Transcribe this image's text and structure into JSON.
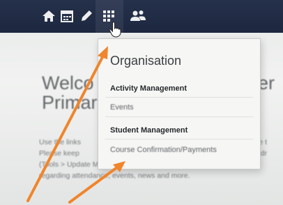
{
  "navbar": {
    "icons": [
      "home-icon",
      "calendar-icon",
      "pencil-icon",
      "apps-grid-icon",
      "people-icon"
    ],
    "colors": {
      "background": "#1f2942",
      "icon": "#ffffff"
    }
  },
  "page": {
    "welcome_left": "Welco\nPrimar",
    "welcome_right": "er",
    "body_left": "Use the links\nPlease keep\n(Tools > Update My Details). The school will use this to c\nregarding attendance, events, news and more.",
    "body_right": "ore t\naddr"
  },
  "dropdown": {
    "heading": "Organisation",
    "sections": [
      {
        "title": "Activity Management",
        "items": [
          "Events"
        ]
      },
      {
        "title": "Student Management",
        "items": [
          "Course Confirmation/Payments"
        ]
      }
    ]
  },
  "annotation": {
    "arrow_color": "#f0852c"
  }
}
